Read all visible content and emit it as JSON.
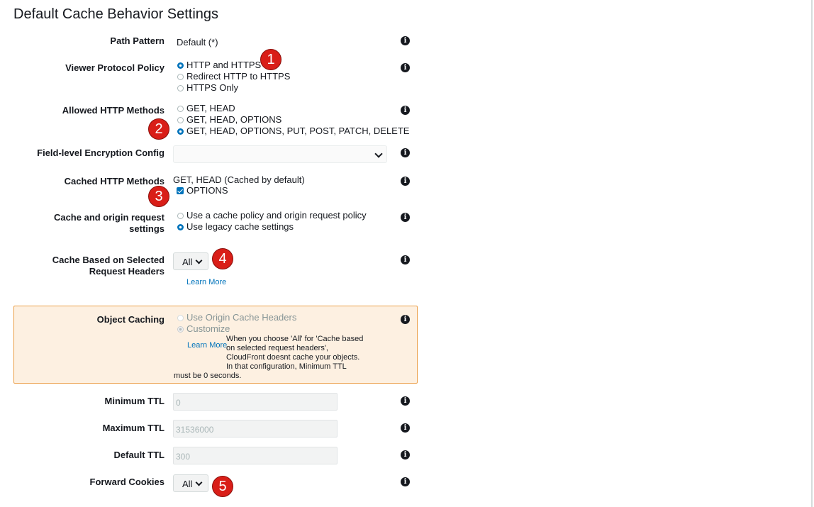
{
  "title": "Default Cache Behavior Settings",
  "path_pattern": {
    "label": "Path Pattern",
    "value": "Default (*)"
  },
  "viewer_protocol": {
    "label": "Viewer Protocol Policy",
    "options": [
      "HTTP and HTTPS",
      "Redirect HTTP to HTTPS",
      "HTTPS Only"
    ],
    "selected": "HTTP and HTTPS"
  },
  "allowed_methods": {
    "label": "Allowed HTTP Methods",
    "options": [
      "GET, HEAD",
      "GET, HEAD, OPTIONS",
      "GET, HEAD, OPTIONS, PUT, POST, PATCH, DELETE"
    ],
    "selected": "GET, HEAD, OPTIONS, PUT, POST, PATCH, DELETE"
  },
  "field_encryption": {
    "label": "Field-level Encryption Config",
    "value": ""
  },
  "cached_methods": {
    "label": "Cached HTTP Methods",
    "default_text": "GET, HEAD (Cached by default)",
    "checkbox_label": "OPTIONS",
    "checked": true
  },
  "cache_origin": {
    "label_line1": "Cache and origin request",
    "label_line2": "settings",
    "options": [
      "Use a cache policy and origin request policy",
      "Use legacy cache settings"
    ],
    "selected": "Use legacy cache settings"
  },
  "cache_headers": {
    "label_line1": "Cache Based on Selected",
    "label_line2": "Request Headers",
    "value": "All",
    "learn_more": "Learn More"
  },
  "object_caching": {
    "label": "Object Caching",
    "options": [
      "Use Origin Cache Headers",
      "Customize"
    ],
    "selected": "Customize",
    "learn_more": "Learn More",
    "warning_lines": [
      "When you choose 'All' for 'Cache based",
      "on selected request headers',",
      "CloudFront doesnt cache your objects.",
      "In that configuration, Minimum TTL",
      "must be 0 seconds."
    ]
  },
  "min_ttl": {
    "label": "Minimum TTL",
    "value": "0"
  },
  "max_ttl": {
    "label": "Maximum TTL",
    "value": "31536000"
  },
  "default_ttl": {
    "label": "Default TTL",
    "value": "300"
  },
  "forward_cookies": {
    "label": "Forward Cookies",
    "value": "All"
  },
  "info_icon_glyph": "i",
  "badges": [
    "1",
    "2",
    "3",
    "4",
    "5"
  ],
  "colors": {
    "accent": "#0073bb",
    "badge": "#d91e18",
    "warning_bg": "#fdf0e1",
    "warning_border": "#eb9f49"
  }
}
